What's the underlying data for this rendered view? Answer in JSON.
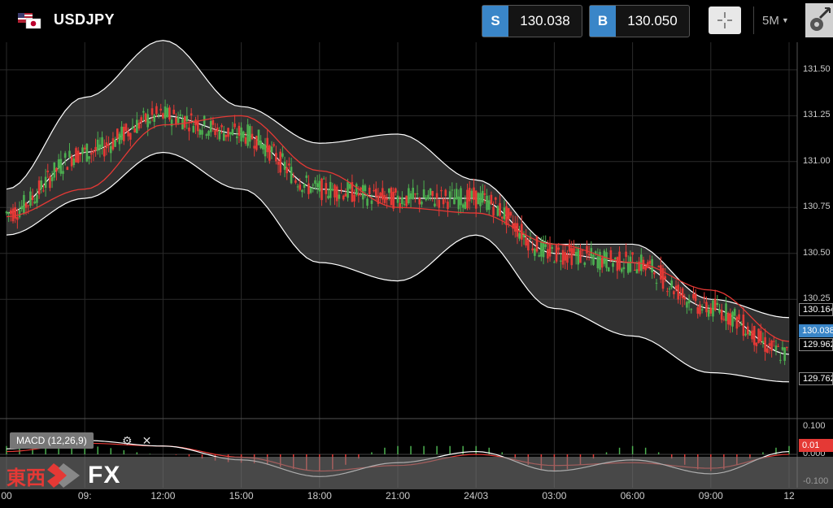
{
  "header": {
    "symbol": "USDJPY",
    "sell_tag": "S",
    "sell_price": "130.038",
    "buy_tag": "B",
    "buy_price": "130.050",
    "timeframe": "5M"
  },
  "macd": {
    "label": "MACD (12,26,9)",
    "settings_icon": "gear-icon",
    "close_icon": "close-icon"
  },
  "brand": {
    "kanji": "東西",
    "fx": "FX"
  },
  "price_axis": [
    "131.50",
    "131.25",
    "131.00",
    "130.75",
    "130.50",
    "130.25"
  ],
  "macd_axis": [
    "0.100",
    "0.000",
    "-0.100"
  ],
  "price_boxes": {
    "upper_band": "130.164",
    "current": "130.038",
    "middle": "129.962",
    "lower_band": "129.762",
    "macd_value": "0.01"
  },
  "time_axis": [
    "00",
    "09:",
    "12:00",
    "15:00",
    "18:00",
    "21:00",
    "24/03",
    "03:00",
    "06:00",
    "09:00",
    "12"
  ],
  "colors": {
    "accent": "#3a86c8",
    "ma_line": "#e53935",
    "candle_up": "#4caf50",
    "candle_down": "#e53935",
    "band": "#ffffff",
    "macd_signal": "#e53935",
    "macd_line": "#ffffff"
  },
  "chart_data": {
    "type": "line",
    "title": "USDJPY",
    "timeframe": "5M",
    "ylim": [
      129.6,
      131.65
    ],
    "x": [
      "00",
      "09:",
      "12:00",
      "15:00",
      "18:00",
      "21:00",
      "24/03",
      "03:00",
      "06:00",
      "09:00",
      "12"
    ],
    "series": [
      {
        "name": "upper band",
        "values": [
          130.85,
          131.35,
          131.66,
          131.3,
          131.1,
          131.15,
          130.9,
          130.55,
          130.55,
          130.25,
          130.15
        ]
      },
      {
        "name": "middle band",
        "values": [
          130.72,
          131.05,
          131.25,
          131.15,
          130.85,
          130.8,
          130.8,
          130.5,
          130.45,
          130.2,
          129.95
        ]
      },
      {
        "name": "lower band",
        "values": [
          130.6,
          130.8,
          131.05,
          130.85,
          130.45,
          130.35,
          130.6,
          130.2,
          130.05,
          129.85,
          129.8
        ]
      },
      {
        "name": "moving average",
        "values": [
          130.7,
          130.85,
          131.2,
          131.25,
          130.95,
          130.75,
          130.72,
          130.55,
          130.45,
          130.3,
          130.02
        ]
      }
    ],
    "macd_ylim": [
      -0.12,
      0.12
    ],
    "macd_series": [
      {
        "name": "MACD",
        "values": [
          0.02,
          0.05,
          0.03,
          -0.02,
          -0.08,
          -0.03,
          0.01,
          -0.06,
          -0.02,
          -0.07,
          0.01
        ]
      },
      {
        "name": "signal",
        "values": [
          0.01,
          0.04,
          0.03,
          -0.01,
          -0.06,
          -0.04,
          0.0,
          -0.04,
          -0.03,
          -0.05,
          0.0
        ]
      }
    ],
    "last_price": 130.038
  }
}
